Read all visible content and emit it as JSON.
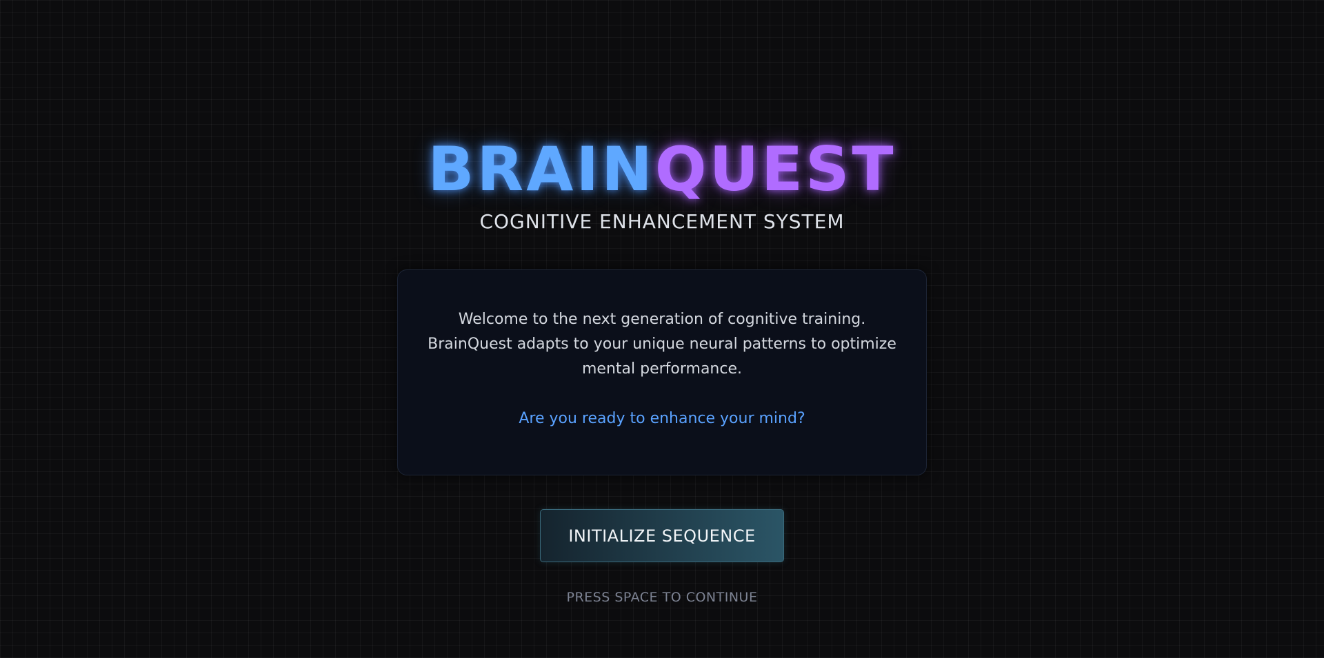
{
  "logo": {
    "part_1": "BRAIN",
    "part_2": "QUEST",
    "color_1": "#5fa8ff",
    "color_2": "#b06cff"
  },
  "subtitle": "COGNITIVE ENHANCEMENT SYSTEM",
  "intro": {
    "line_1": "Welcome to the next generation of cognitive training. BrainQuest adapts to your unique neural patterns to optimize mental performance.",
    "question": "Are you ready to enhance your mind?"
  },
  "start_button": {
    "label": "INITIALIZE SEQUENCE"
  },
  "hint": "PRESS SPACE TO CONTINUE",
  "theme": {
    "background": "#0c0c0e",
    "accent_blue": "#5aa2ff",
    "button_gradient_start": "#15242e",
    "button_gradient_end": "#2b5566"
  }
}
